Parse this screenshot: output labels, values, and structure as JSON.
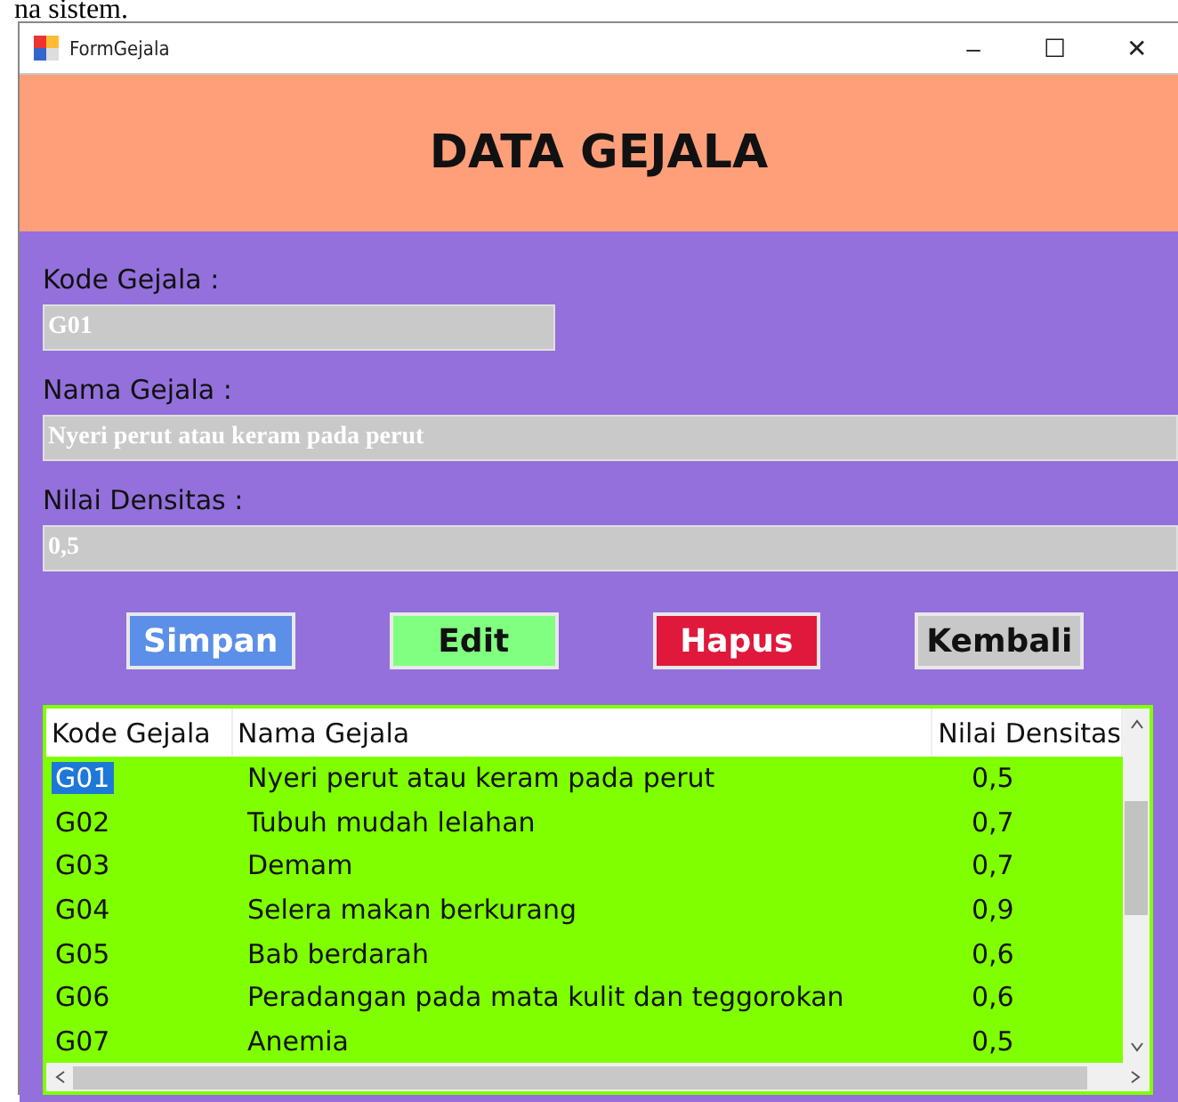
{
  "document_text": "na sistem.",
  "window": {
    "title": "FormGejala",
    "controls": [
      "–",
      "☐",
      "✕"
    ]
  },
  "header": {
    "title": "DATA GEJALA"
  },
  "form": {
    "fields": [
      {
        "label": "Kode Gejala :",
        "value": "G01",
        "wide": false
      },
      {
        "label": "Nama Gejala :",
        "value": "Nyeri perut atau keram pada perut",
        "wide": true
      },
      {
        "label": "Nilai Densitas :",
        "value": "0,5",
        "wide": true
      }
    ]
  },
  "buttons": [
    {
      "label": "Simpan",
      "color": "#5b8fe8"
    },
    {
      "label": "Edit",
      "color": "#80ff80"
    },
    {
      "label": "Hapus",
      "color": "#e0183c"
    },
    {
      "label": "Kembali",
      "color": "#c8c8c8"
    }
  ],
  "table": {
    "columns": [
      "Kode Gejala",
      "Nama Gejala",
      "Nilai Densitas"
    ],
    "rows": [
      {
        "cells": [
          "G01",
          "Nyeri perut atau keram pada perut",
          "0,5"
        ],
        "selected": true
      },
      {
        "cells": [
          "G02",
          "Tubuh mudah lelahan",
          "0,7"
        ],
        "selected": false
      },
      {
        "cells": [
          "G03",
          "Demam",
          "0,7"
        ],
        "selected": false
      },
      {
        "cells": [
          "G04",
          "Selera makan berkurang",
          "0,9"
        ],
        "selected": false
      },
      {
        "cells": [
          "G05",
          "Bab berdarah",
          "0,6"
        ],
        "selected": false
      },
      {
        "cells": [
          "G06",
          "Peradangan pada mata kulit dan teggorokan",
          "0,6"
        ],
        "selected": false
      },
      {
        "cells": [
          "G07",
          "Anemia",
          "0,5"
        ],
        "selected": false
      }
    ]
  }
}
